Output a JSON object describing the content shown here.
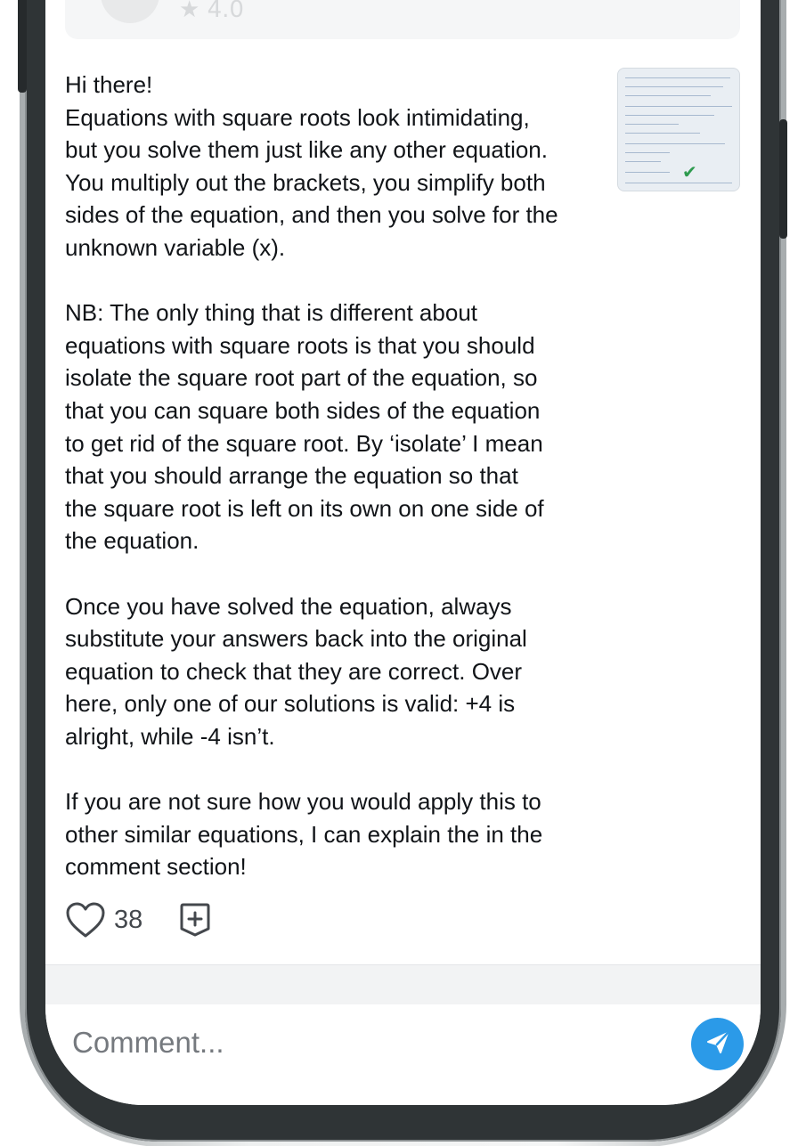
{
  "previous_answer": {
    "rating_text": "4.0"
  },
  "answer": {
    "text": "Hi there!\nEquations with square roots look intimidating,\nbut you solve them just like any other equation.\nYou multiply out the brackets, you simplify both\nsides of the equation, and then you solve for the\nunknown variable (x).\n\nNB: The only thing that is different about\nequations with square roots is that you should\nisolate the square root part of the equation, so\nthat you can square both sides of the equation\nto get rid of the square root. By ‘isolate’ I mean\nthat you should arrange the equation so that\nthe square root is left on its own on one side of\nthe equation.\n\nOnce you have solved the equation, always\nsubstitute your answers back into the original\nequation to check that they are correct. Over\nhere, only one of our solutions is valid: +4 is\nalright, while -4 isn’t.\n\nIf you are not sure how you would apply this to\nother similar equations, I can explain the in the\ncomment section!",
    "thumbnail_icon": "handwritten-solution-image",
    "like_count": "38",
    "like_icon": "heart-outline-icon",
    "bookmark_icon": "bookmark-plus-icon"
  },
  "comment_bar": {
    "placeholder": "Comment...",
    "send_icon": "send-plane-icon",
    "send_color": "#2b9ae8"
  }
}
